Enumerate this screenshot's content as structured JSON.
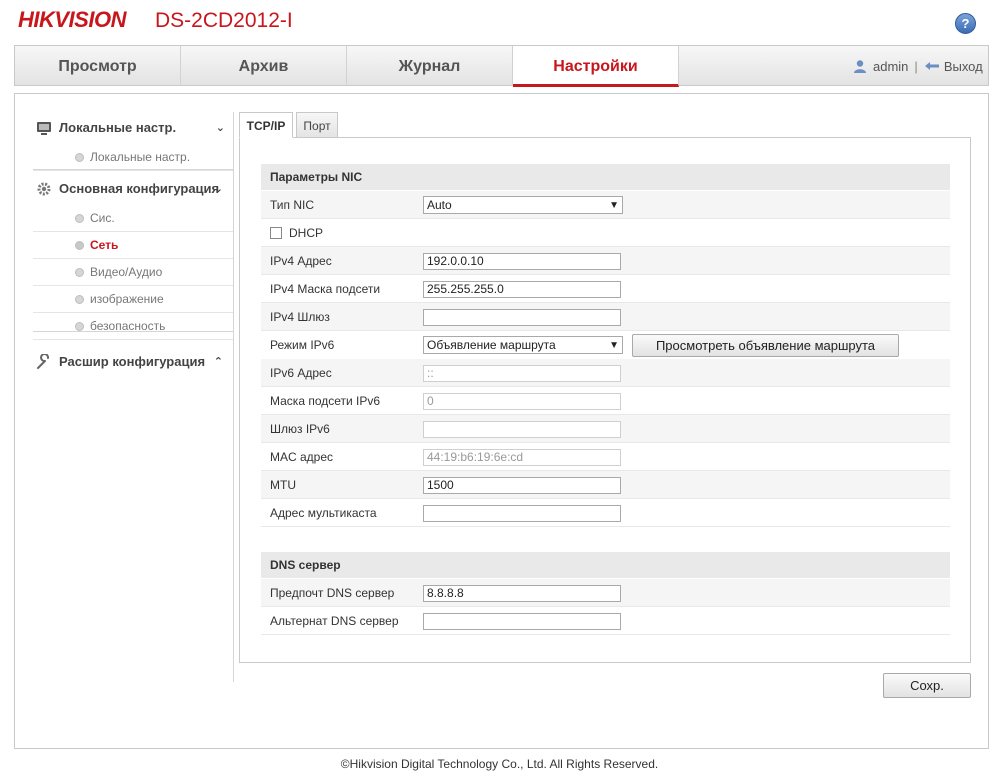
{
  "header": {
    "logo": "HIKVISION",
    "model": "DS-2CD2012-I",
    "help_icon": "?"
  },
  "nav": {
    "tabs": [
      "Просмотр",
      "Архив",
      "Журнал",
      "Настройки"
    ],
    "active": "Настройки",
    "user": "admin",
    "separator": "|",
    "logout": "Выход"
  },
  "sidebar": {
    "groups": [
      {
        "title": "Локальные настр.",
        "chevron": "⌄",
        "icon": "monitor-icon",
        "items": [
          "Локальные настр."
        ]
      },
      {
        "title": "Основная конфигурация",
        "chevron": "⌄",
        "icon": "gear-icon",
        "items": [
          "Сис.",
          "Сеть",
          "Видео/Аудио",
          "изображение",
          "безопасность"
        ]
      },
      {
        "title": "Расшир конфигурация",
        "chevron": "⌃",
        "icon": "wrench-icon",
        "items": []
      }
    ],
    "active_item": "Сеть"
  },
  "tabs": [
    "TCP/IP",
    "Порт"
  ],
  "nic": {
    "title": "Параметры NIC",
    "nic_type_label": "Тип NIC",
    "nic_type_value": "Auto",
    "dhcp_label": "DHCP",
    "dhcp_checked": false,
    "ipv4_label": "IPv4 Адрес",
    "ipv4_value": "192.0.0.10",
    "mask_label": "IPv4 Маска подсети",
    "mask_value": "255.255.255.0",
    "gw_label": "IPv4 Шлюз",
    "gw_value": "",
    "ipv6_mode_label": "Режим IPv6",
    "ipv6_mode_value": "Объявление маршрута",
    "view_route_button": "Просмотреть объявление маршрута",
    "ipv6_addr_label": "IPv6 Адрес",
    "ipv6_addr_value": "::",
    "ipv6_mask_label": "Маска подсети IPv6",
    "ipv6_mask_value": "0",
    "ipv6_gw_label": "Шлюз IPv6",
    "ipv6_gw_value": "",
    "mac_label": "MAC адрес",
    "mac_value": "44:19:b6:19:6e:cd",
    "mtu_label": "MTU",
    "mtu_value": "1500",
    "mcast_label": "Адрес мультикаста",
    "mcast_value": ""
  },
  "dns": {
    "title": "DNS сервер",
    "pref_label": "Предпочт DNS сервер",
    "pref_value": "8.8.8.8",
    "alt_label": "Альтернат DNS сервер",
    "alt_value": ""
  },
  "save_button": "Сохр.",
  "footer": "©Hikvision Digital Technology Co., Ltd. All Rights Reserved.",
  "colors": {
    "brand": "#c8161d",
    "section_bg": "#e9e9e9"
  }
}
